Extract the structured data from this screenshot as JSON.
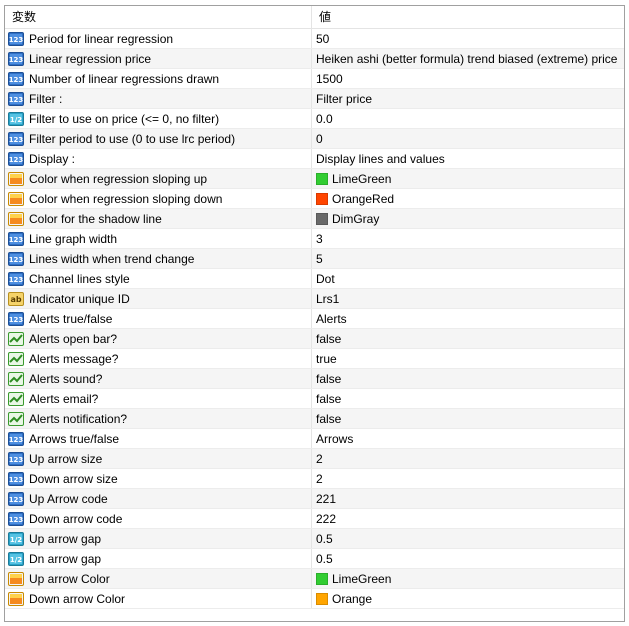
{
  "header": {
    "col_name": "変数",
    "col_value": "値"
  },
  "params": [
    {
      "icon": "int",
      "name": "Period for linear regression",
      "value": "50"
    },
    {
      "icon": "int",
      "name": "Linear regression price",
      "value": "Heiken ashi (better formula) trend biased (extreme) price"
    },
    {
      "icon": "int",
      "name": "Number of linear regressions drawn",
      "value": "1500"
    },
    {
      "icon": "int",
      "name": "Filter :",
      "value": "Filter price"
    },
    {
      "icon": "double",
      "name": "Filter to use on price (<= 0, no filter)",
      "value": "0.0"
    },
    {
      "icon": "int",
      "name": "Filter period to use (0 to use lrc period)",
      "value": "0"
    },
    {
      "icon": "int",
      "name": "Display :",
      "value": "Display lines and values"
    },
    {
      "icon": "color",
      "name": "Color when regression sloping up",
      "value": "LimeGreen",
      "swatch": "#32cd32"
    },
    {
      "icon": "color",
      "name": "Color when regression sloping down",
      "value": "OrangeRed",
      "swatch": "#ff4500"
    },
    {
      "icon": "color",
      "name": "Color for the shadow line",
      "value": "DimGray",
      "swatch": "#696969"
    },
    {
      "icon": "int",
      "name": "Line graph width",
      "value": "3"
    },
    {
      "icon": "int",
      "name": "Lines width when trend change",
      "value": "5"
    },
    {
      "icon": "int",
      "name": "Channel lines style",
      "value": "Dot"
    },
    {
      "icon": "string",
      "name": "Indicator unique ID",
      "value": "Lrs1"
    },
    {
      "icon": "int",
      "name": "Alerts true/false",
      "value": "Alerts"
    },
    {
      "icon": "bool",
      "name": "Alerts open bar?",
      "value": "false"
    },
    {
      "icon": "bool",
      "name": "Alerts message?",
      "value": "true"
    },
    {
      "icon": "bool",
      "name": "Alerts sound?",
      "value": "false"
    },
    {
      "icon": "bool",
      "name": "Alerts email?",
      "value": "false"
    },
    {
      "icon": "bool",
      "name": "Alerts notification?",
      "value": "false"
    },
    {
      "icon": "int",
      "name": "Arrows true/false",
      "value": "Arrows"
    },
    {
      "icon": "int",
      "name": "Up arrow size",
      "value": "2"
    },
    {
      "icon": "int",
      "name": "Down arrow size",
      "value": "2"
    },
    {
      "icon": "int",
      "name": "Up Arrow code",
      "value": "221"
    },
    {
      "icon": "int",
      "name": "Down arrow code",
      "value": "222"
    },
    {
      "icon": "double",
      "name": "Up arrow gap",
      "value": "0.5"
    },
    {
      "icon": "double",
      "name": "Dn arrow gap",
      "value": "0.5"
    },
    {
      "icon": "color",
      "name": "Up arrow Color",
      "value": "LimeGreen",
      "swatch": "#32cd32"
    },
    {
      "icon": "color",
      "name": "Down arrow Color",
      "value": "Orange",
      "swatch": "#ffa500"
    }
  ]
}
